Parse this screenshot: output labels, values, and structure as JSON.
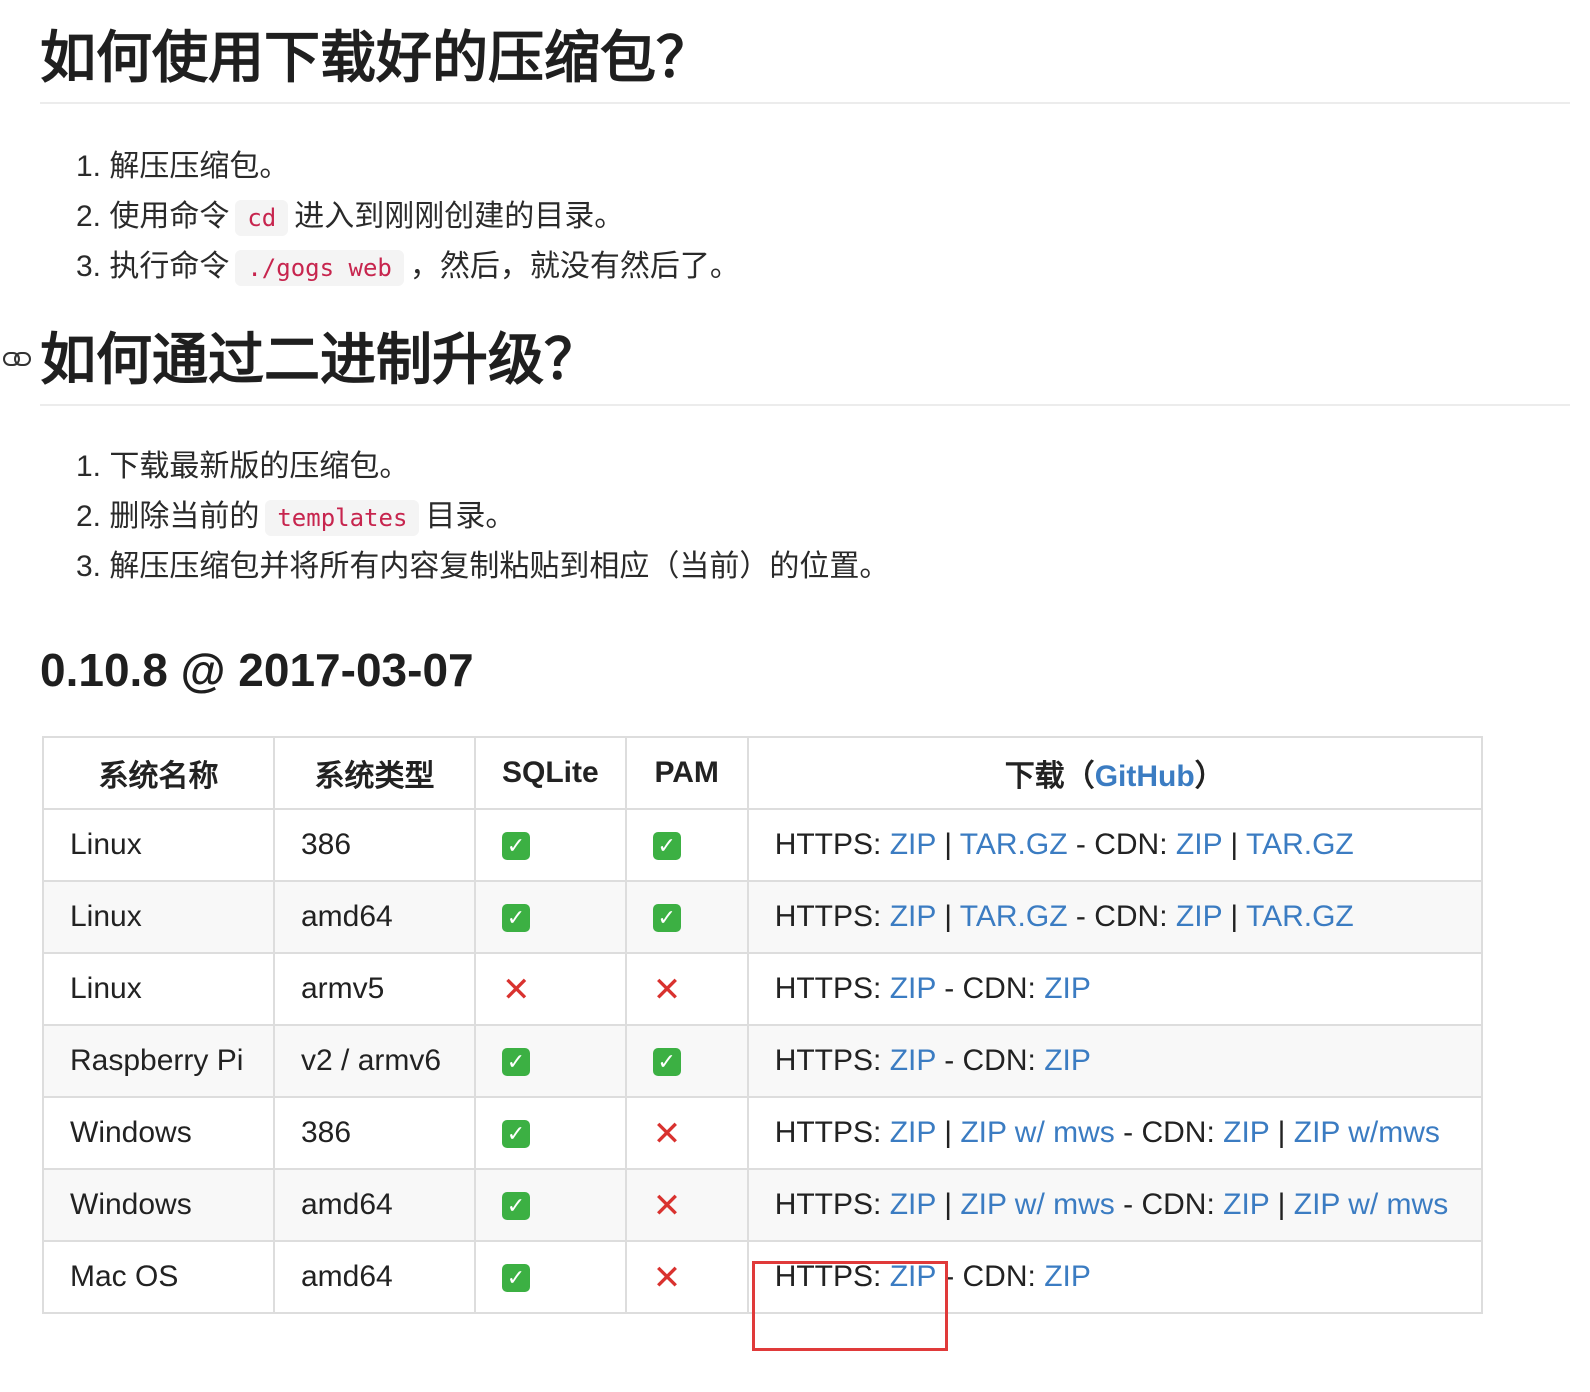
{
  "usage": {
    "heading": "如何使用下载好的压缩包？",
    "steps": {
      "s1": "1. 解压压缩包。",
      "s2_pre": "2. 使用命令",
      "s2_code": "cd",
      "s2_post": "进入到刚刚创建的目录。",
      "s3_pre": "3. 执行命令",
      "s3_code": "./gogs web",
      "s3_post": "，然后，就没有然后了。"
    }
  },
  "upgrade": {
    "heading": "如何通过二进制升级？",
    "steps": {
      "s1": "1. 下载最新版的压缩包。",
      "s2_pre": "2. 删除当前的",
      "s2_code": "templates",
      "s2_post": "目录。",
      "s3": "3. 解压压缩包并将所有内容复制粘贴到相应（当前）的位置。"
    }
  },
  "release": {
    "title": "0.10.8 @ 2017-03-07"
  },
  "table": {
    "headers": {
      "os": "系统名称",
      "arch": "系统类型",
      "sqlite": "SQLite",
      "pam": "PAM",
      "download_pre": "下载（",
      "download_link": "GitHub",
      "download_post": "）"
    },
    "rows": [
      {
        "os": "Linux",
        "arch": "386",
        "sqlite": "yes",
        "pam": "yes",
        "https_label": "HTTPS:",
        "https_link1": "ZIP",
        "sep1": "|",
        "https_link2": "TAR.GZ",
        "cdn_label": "- CDN:",
        "cdn_link1": "ZIP",
        "sep2": "|",
        "cdn_link2": "TAR.GZ"
      },
      {
        "os": "Linux",
        "arch": "amd64",
        "sqlite": "yes",
        "pam": "yes",
        "https_label": "HTTPS:",
        "https_link1": "ZIP",
        "sep1": "|",
        "https_link2": "TAR.GZ",
        "cdn_label": "- CDN:",
        "cdn_link1": "ZIP",
        "sep2": "|",
        "cdn_link2": "TAR.GZ"
      },
      {
        "os": "Linux",
        "arch": "armv5",
        "sqlite": "no",
        "pam": "no",
        "https_label": "HTTPS:",
        "https_link1": "ZIP",
        "cdn_label": "- CDN:",
        "cdn_link1": "ZIP"
      },
      {
        "os": "Raspberry Pi",
        "arch": "v2 / armv6",
        "sqlite": "yes",
        "pam": "yes",
        "https_label": "HTTPS:",
        "https_link1": "ZIP",
        "cdn_label": "- CDN:",
        "cdn_link1": "ZIP"
      },
      {
        "os": "Windows",
        "arch": "386",
        "sqlite": "yes",
        "pam": "no",
        "https_label": "HTTPS:",
        "https_link1": "ZIP",
        "sep1": "|",
        "https_link2": "ZIP w/ mws",
        "cdn_label": "- CDN:",
        "cdn_link1": "ZIP",
        "sep2": "|",
        "cdn_link2": "ZIP w/mws"
      },
      {
        "os": "Windows",
        "arch": "amd64",
        "sqlite": "yes",
        "pam": "no",
        "https_label": "HTTPS:",
        "https_link1": "ZIP",
        "sep1": "|",
        "https_link2": "ZIP w/ mws",
        "cdn_label": "- CDN:",
        "cdn_link1": "ZIP",
        "sep2": "|",
        "cdn_link2": "ZIP w/ mws"
      },
      {
        "os": "Mac OS",
        "arch": "amd64",
        "sqlite": "yes",
        "pam": "no",
        "https_label": "HTTPS:",
        "https_link1": "ZIP",
        "cdn_label": "- CDN:",
        "cdn_link1": "ZIP"
      }
    ]
  },
  "icons": {
    "check": "✓",
    "cross": "✕",
    "check_color": "#3cb043",
    "cross_color": "#d9322f",
    "link_color": "#3b7cc2",
    "highlight_color": "#e03a3a"
  }
}
